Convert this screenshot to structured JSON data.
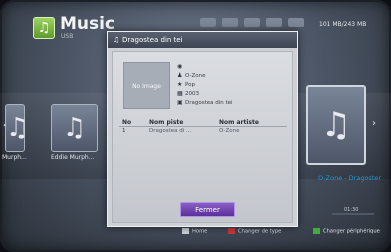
{
  "header": {
    "title": "Music",
    "subtitle": "USB",
    "storage": "101 MB/243 MB"
  },
  "background": {
    "left_thumb_label": "Murph...",
    "center_thumb_label": "Eddie Murph...",
    "right_caption": "O-Zone - Dragoster",
    "right_small": "01:30"
  },
  "dialog": {
    "title": "Dragostea din tei",
    "no_image": "No Image",
    "meta": {
      "artist": "O-Zone",
      "genre": "Pop",
      "year": "2003",
      "album": "Dragostea din tei"
    },
    "table": {
      "headers": [
        "No",
        "Nom piste",
        "Nom artiste"
      ],
      "rows": [
        [
          "1",
          "Dragostea di ...",
          "O-Zone"
        ]
      ]
    },
    "close_label": "Fermer"
  },
  "legend": {
    "home": "Home",
    "change_type": "Changer de type",
    "change_device": "Changer périphérique"
  },
  "colors": {
    "accent_blue": "#1d9bd6",
    "button_purple": "#6b3fae",
    "key_green": "#3fae3f",
    "key_red": "#c83a3a"
  }
}
